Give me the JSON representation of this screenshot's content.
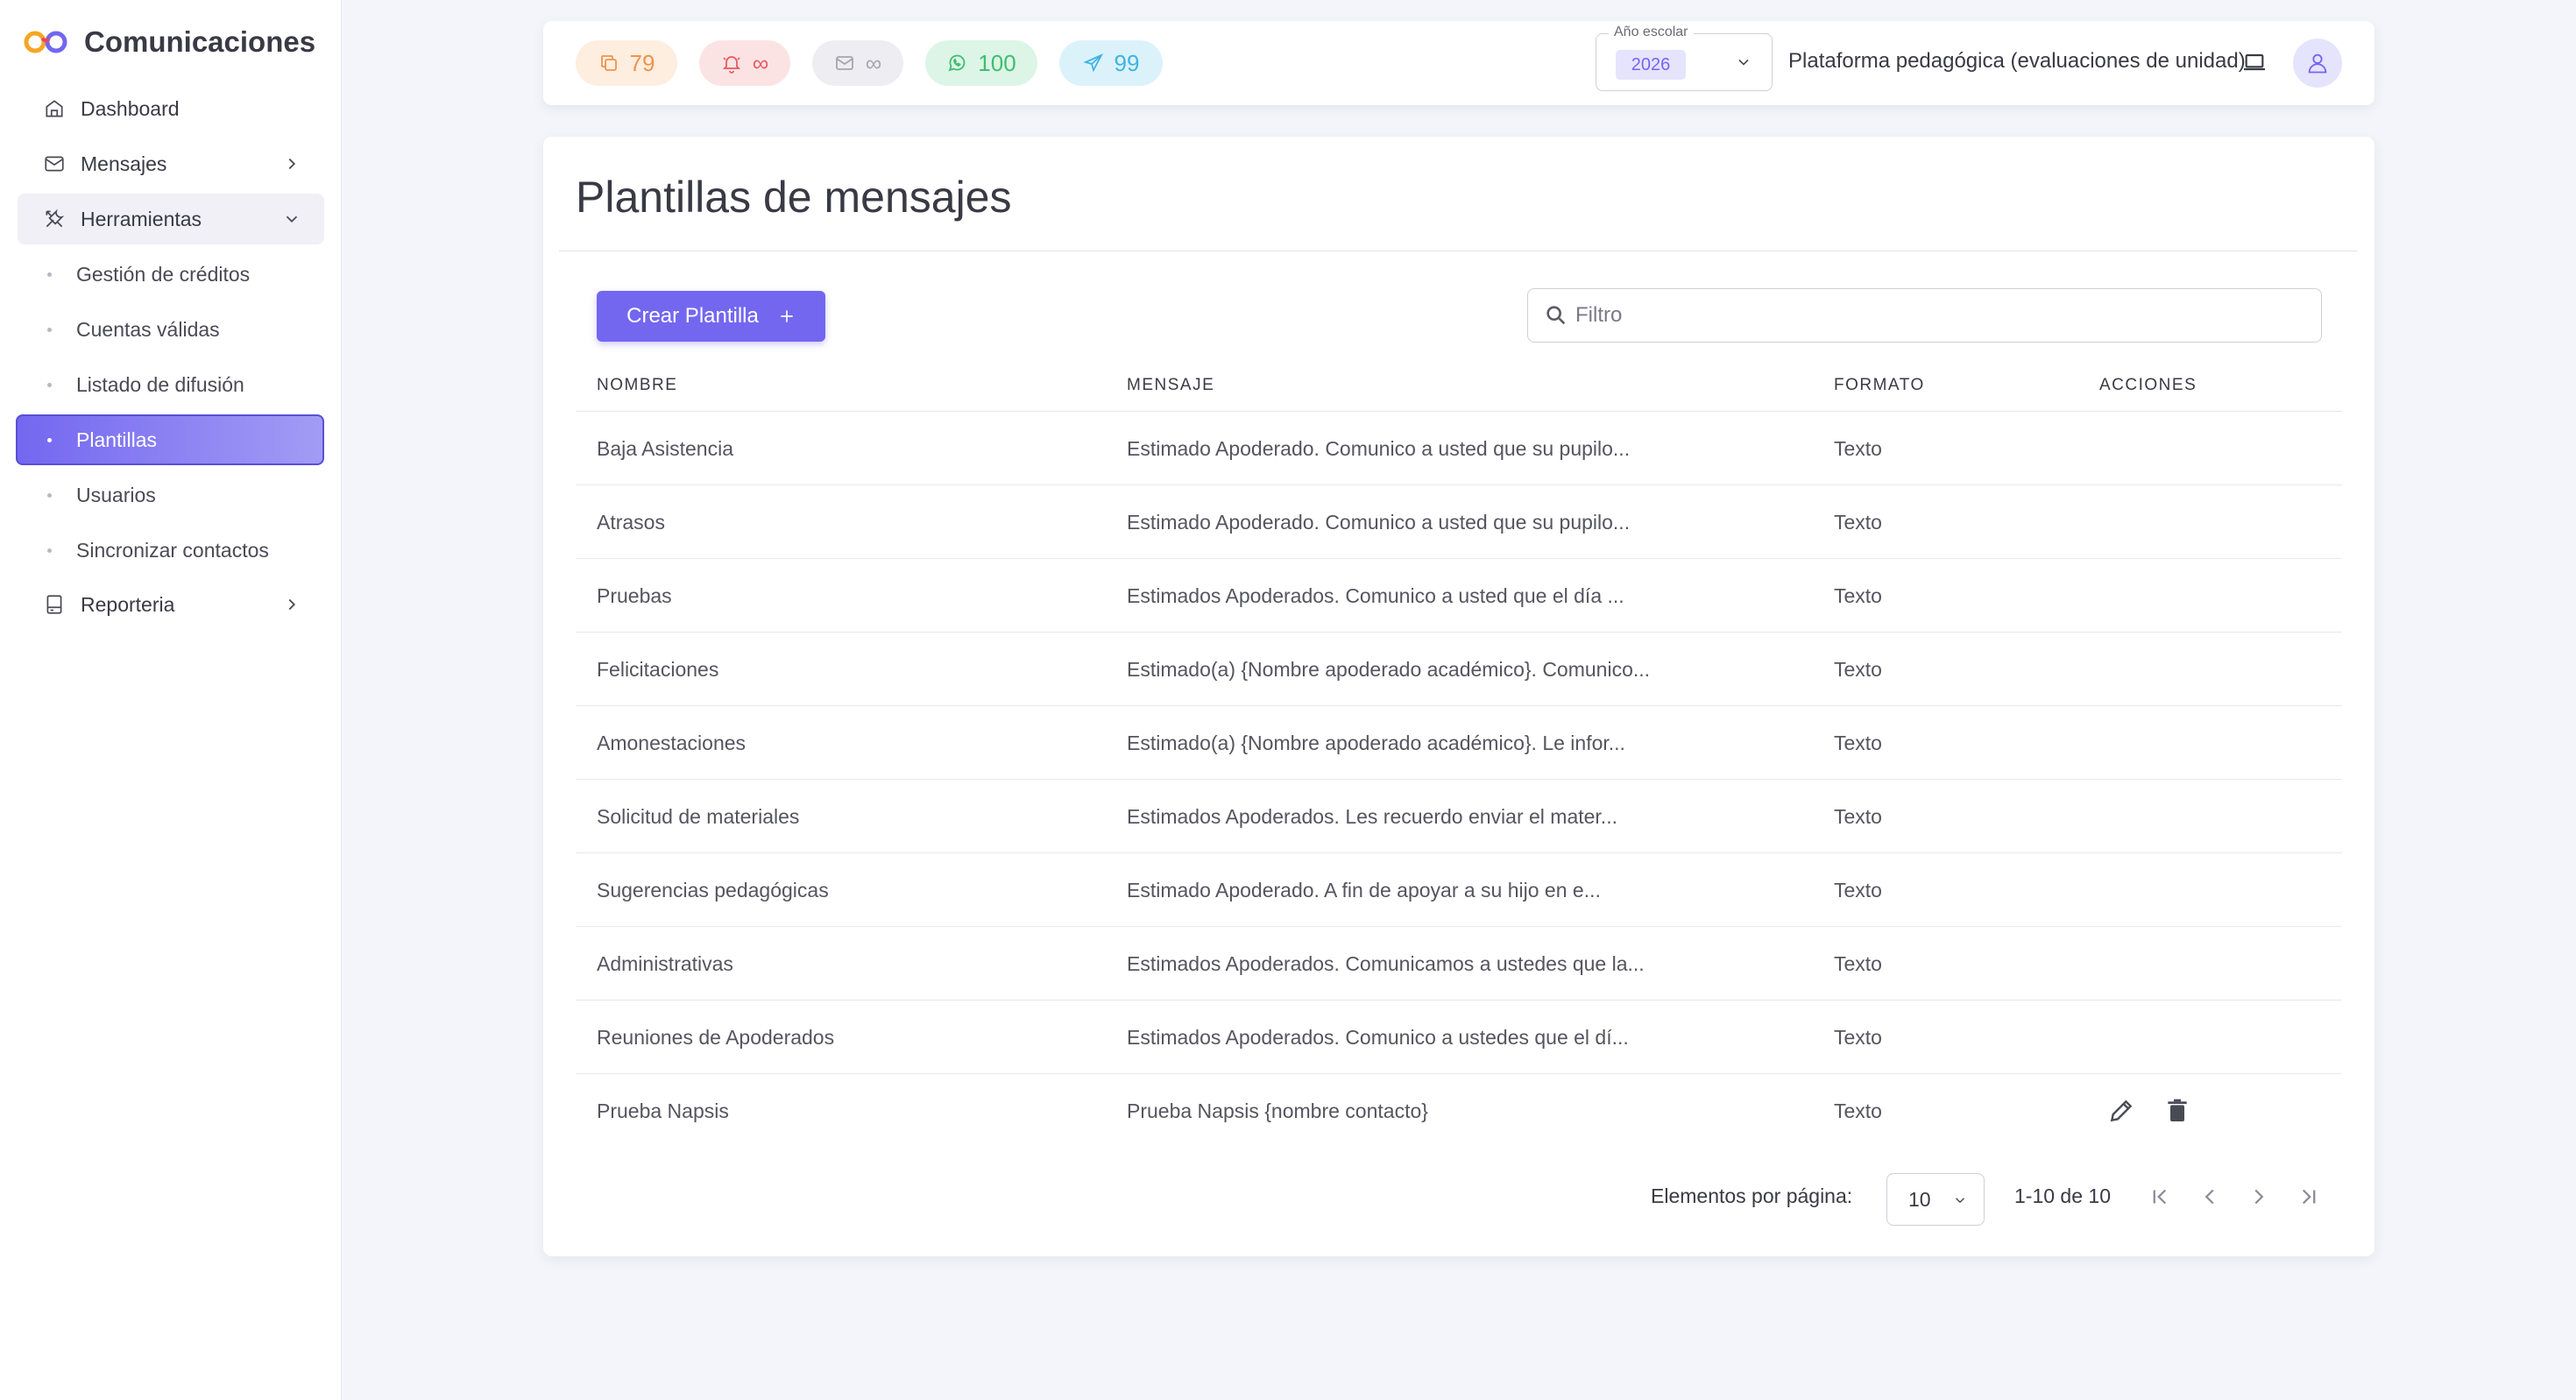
{
  "app": {
    "title": "Comunicaciones",
    "logo_colors": [
      "#f5a623",
      "#e94560",
      "#7367f0"
    ]
  },
  "sidebar": {
    "items": [
      {
        "label": "Dashboard",
        "icon": "home-icon"
      },
      {
        "label": "Mensajes",
        "icon": "mail-icon",
        "chevron": "right"
      },
      {
        "label": "Herramientas",
        "icon": "tools-icon",
        "chevron": "down",
        "expanded": true
      },
      {
        "label": "Reporteria",
        "icon": "report-icon",
        "chevron": "right"
      }
    ],
    "subitems": [
      {
        "label": "Gestión de créditos"
      },
      {
        "label": "Cuentas válidas"
      },
      {
        "label": "Listado de difusión"
      },
      {
        "label": "Plantillas",
        "active": true
      },
      {
        "label": "Usuarios"
      },
      {
        "label": "Sincronizar contactos"
      }
    ]
  },
  "topbar": {
    "counters": [
      {
        "name": "credits",
        "icon": "copy-icon",
        "value": "79",
        "color": "#f0924a"
      },
      {
        "name": "alerts",
        "icon": "bell-icon",
        "value": "∞",
        "color": "#e85a5f"
      },
      {
        "name": "email",
        "icon": "mail-icon",
        "value": "∞",
        "color": "#a5a5b0"
      },
      {
        "name": "whatsapp",
        "icon": "whatsapp-icon",
        "value": "100",
        "color": "#3fbe6f"
      },
      {
        "name": "telegram",
        "icon": "send-icon",
        "value": "99",
        "color": "#3fb4e0"
      }
    ],
    "year_select": {
      "legend": "Año escolar",
      "value": "2026"
    },
    "platform_label": "Plataforma pedagógica (evaluaciones de unidad)"
  },
  "main": {
    "title": "Plantillas de mensajes",
    "create_button": "Crear Plantilla",
    "filter_placeholder": "Filtro",
    "table": {
      "columns": [
        "NOMBRE",
        "MENSAJE",
        "FORMATO",
        "ACCIONES"
      ],
      "rows": [
        {
          "name": "Baja Asistencia",
          "message": "Estimado Apoderado. Comunico a usted que su pupilo...",
          "format": "Texto"
        },
        {
          "name": "Atrasos",
          "message": "Estimado Apoderado. Comunico a usted que su pupilo...",
          "format": "Texto"
        },
        {
          "name": "Pruebas",
          "message": "Estimados Apoderados. Comunico a usted que el día ...",
          "format": "Texto"
        },
        {
          "name": "Felicitaciones",
          "message": "Estimado(a) {Nombre apoderado académico}. Comunico...",
          "format": "Texto"
        },
        {
          "name": "Amonestaciones",
          "message": "Estimado(a) {Nombre apoderado académico}. Le infor...",
          "format": "Texto"
        },
        {
          "name": "Solicitud de materiales",
          "message": "Estimados Apoderados. Les recuerdo enviar el mater...",
          "format": "Texto"
        },
        {
          "name": "Sugerencias pedagógicas",
          "message": "Estimado Apoderado. A fin de apoyar a su hijo en e...",
          "format": "Texto"
        },
        {
          "name": "Administrativas",
          "message": "Estimados Apoderados. Comunicamos a ustedes que la...",
          "format": "Texto"
        },
        {
          "name": "Reuniones de Apoderados",
          "message": "Estimados Apoderados. Comunico a ustedes que el dí...",
          "format": "Texto"
        },
        {
          "name": "Prueba Napsis",
          "message": "Prueba Napsis {nombre contacto}",
          "format": "Texto",
          "actions": [
            "edit-icon",
            "delete-icon"
          ]
        }
      ]
    },
    "pagination": {
      "label": "Elementos por página:",
      "page_size": "10",
      "range": "1-10 de 10"
    }
  },
  "colors": {
    "accent": "#7367f0",
    "background": "#f4f5fa"
  }
}
